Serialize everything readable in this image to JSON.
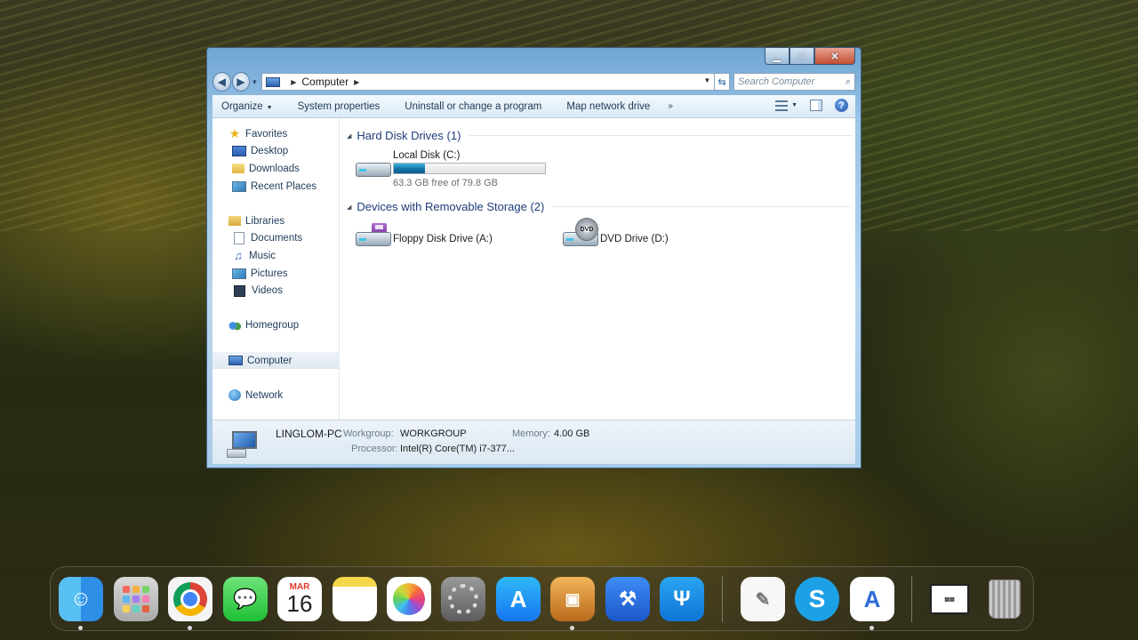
{
  "explorer": {
    "address_crumb": "Computer",
    "search_placeholder": "Search Computer",
    "commands": {
      "organize": "Organize",
      "system_properties": "System properties",
      "uninstall": "Uninstall or change a program",
      "map_drive": "Map network drive",
      "more": "»"
    },
    "nav": {
      "favorites": "Favorites",
      "desktop": "Desktop",
      "downloads": "Downloads",
      "recent": "Recent Places",
      "libraries": "Libraries",
      "documents": "Documents",
      "music": "Music",
      "pictures": "Pictures",
      "videos": "Videos",
      "homegroup": "Homegroup",
      "computer": "Computer",
      "network": "Network"
    },
    "groups": {
      "hard_disks": "Hard Disk Drives (1)",
      "removable": "Devices with Removable Storage (2)"
    },
    "drives": {
      "local": {
        "name": "Local Disk (C:)",
        "free": "63.3 GB free of 79.8 GB",
        "used_fraction": 0.207
      },
      "floppy": {
        "name": "Floppy Disk Drive (A:)"
      },
      "dvd": {
        "name": "DVD Drive (D:)",
        "badge": "DVD"
      }
    },
    "details": {
      "pc_name": "LINGLOM-PC",
      "workgroup_label": "Workgroup:",
      "workgroup": "WORKGROUP",
      "memory_label": "Memory:",
      "memory": "4.00 GB",
      "processor_label": "Processor:",
      "processor": "Intel(R) Core(TM) i7-377..."
    },
    "colors": {
      "accent": "#1e3d7a",
      "usage_fill": "#1273a6"
    }
  },
  "dock": {
    "calendar_month": "MAR",
    "calendar_day": "16",
    "apps": [
      "finder-icon",
      "launchpad-icon",
      "chrome-icon",
      "messages-icon",
      "calendar-icon",
      "notes-icon",
      "photos-icon",
      "system-preferences-icon",
      "app-store-icon",
      "preview-icon",
      "xcode-icon",
      "fork-icon",
      "textedit-icon",
      "skype-icon",
      "instruments-icon",
      "screenshot-icon",
      "trash-icon"
    ]
  }
}
